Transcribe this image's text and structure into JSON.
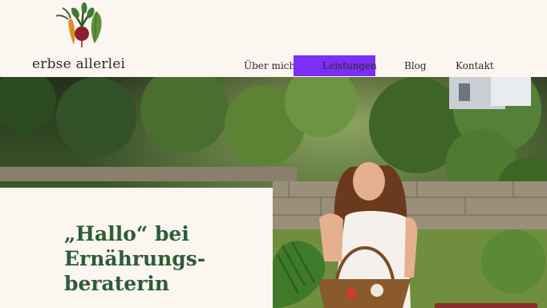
{
  "brand": {
    "name": "erbse allerlei",
    "logo_icon": "vegetables-logo-icon"
  },
  "nav": {
    "items": [
      {
        "label": "Über mich"
      },
      {
        "label": "Leistungen",
        "active": true
      },
      {
        "label": "Blog"
      },
      {
        "label": "Kontakt"
      }
    ],
    "active_color": "#7b2ff7"
  },
  "hero": {
    "headline_lines": [
      "„Hallo“ bei",
      "Ernährungs-",
      "beraterin"
    ],
    "headline_color": "#2e5c36",
    "photo": "woman-with-vegetable-basket-in-garden"
  },
  "colors": {
    "background": "#fbf6f0",
    "cta": "#8a2f2a"
  }
}
